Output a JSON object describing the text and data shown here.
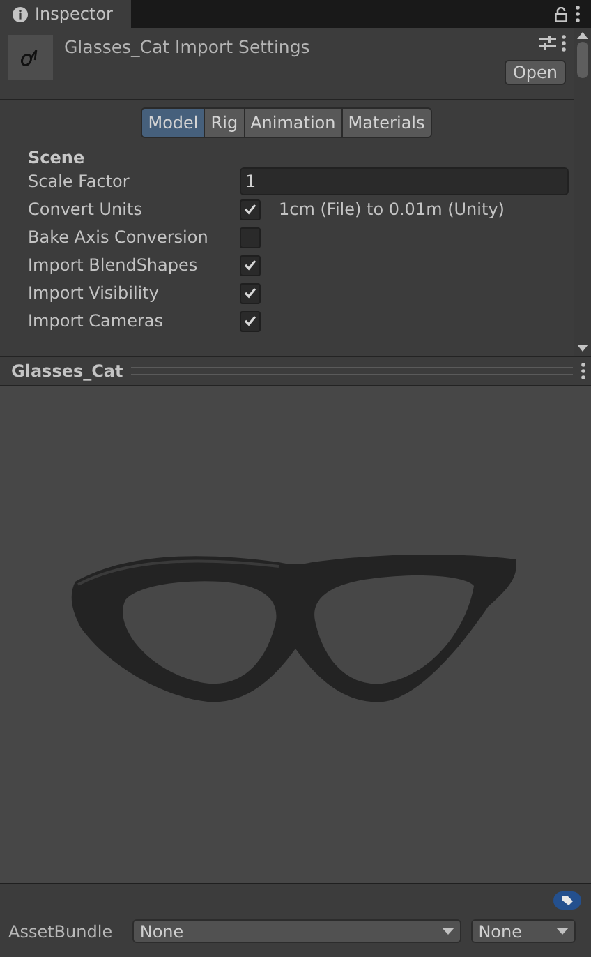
{
  "window": {
    "tab": "Inspector"
  },
  "header": {
    "title": "Glasses_Cat Import Settings",
    "open_button": "Open"
  },
  "tabs": [
    {
      "label": "Model",
      "selected": true
    },
    {
      "label": "Rig",
      "selected": false
    },
    {
      "label": "Animation",
      "selected": false
    },
    {
      "label": "Materials",
      "selected": false
    }
  ],
  "section": "Scene",
  "fields": [
    {
      "kind": "text",
      "label": "Scale Factor",
      "value": "1"
    },
    {
      "kind": "checkbox",
      "label": "Convert Units",
      "checked": true,
      "note": "1cm (File) to 0.01m (Unity)"
    },
    {
      "kind": "checkbox",
      "label": "Bake Axis Conversion",
      "checked": false
    },
    {
      "kind": "checkbox",
      "label": "Import BlendShapes",
      "checked": true
    },
    {
      "kind": "checkbox",
      "label": "Import Visibility",
      "checked": true
    },
    {
      "kind": "checkbox",
      "label": "Import Cameras",
      "checked": true
    }
  ],
  "preview": {
    "title": "Glasses_Cat"
  },
  "asset_bundle": {
    "label": "AssetBundle",
    "name": "None",
    "variant": "None"
  }
}
